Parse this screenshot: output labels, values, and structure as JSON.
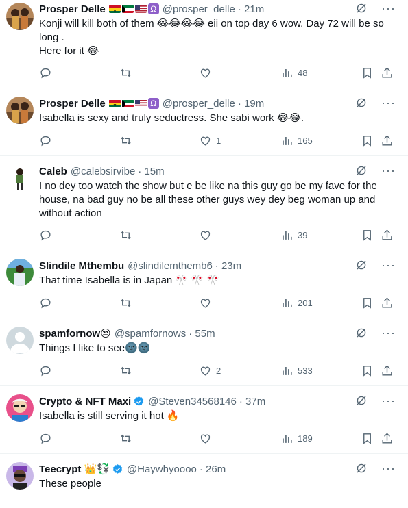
{
  "tweets": [
    {
      "name": "Prosper Delle",
      "handle": "@prosper_delle",
      "time": "· 21m",
      "text": "Konji will kill both of them  😂😂😂😂 eii on top day 6 wow.  Day 72 will be so long .\nHere for it 😂",
      "replies": "",
      "retweets": "",
      "likes": "",
      "views": "48",
      "avatar": "prosper"
    },
    {
      "name": "Prosper Delle",
      "handle": "@prosper_delle",
      "time": "· 19m",
      "text": "Isabella is sexy and truly seductress. She sabi work 😂😂.",
      "replies": "",
      "retweets": "",
      "likes": "1",
      "views": "165",
      "avatar": "prosper"
    },
    {
      "name": "Caleb",
      "handle": "@calebsirvibe",
      "time": "· 15m",
      "text": "I no dey too watch the show but e be like na this guy go be my fave for the house, na bad guy no be all these other guys wey dey beg woman up and without action",
      "replies": "",
      "retweets": "",
      "likes": "",
      "views": "39",
      "avatar": "caleb"
    },
    {
      "name": "Slindile Mthembu",
      "handle": "@slindilemthemb6",
      "time": "· 23m",
      "text": "That time Isabella is in Japan 🎌 🎌 🎌",
      "replies": "",
      "retweets": "",
      "likes": "",
      "views": "201",
      "avatar": "slindile"
    },
    {
      "name": "spamfornow😒",
      "handle": "@spamfornows",
      "time": "· 55m",
      "text": "Things I like to see🌚🌚",
      "replies": "",
      "retweets": "",
      "likes": "2",
      "views": "533",
      "avatar": "default"
    },
    {
      "name": "Crypto & NFT Maxi",
      "handle": "@Steven34568146",
      "time": "· 37m",
      "text": "Isabella is still serving it hot 🔥",
      "replies": "",
      "retweets": "",
      "likes": "",
      "views": "189",
      "avatar": "crypto",
      "verified": true
    },
    {
      "name": "Teecrypt 👑💱",
      "handle": "@Haywhyoooo",
      "time": "· 26m",
      "text": "These people",
      "avatar": "teecrypt",
      "verified": true
    }
  ],
  "colors": {
    "text": "#0f1419",
    "secondary": "#536471",
    "verified": "#1d9bf0",
    "divider": "#eff3f4"
  },
  "icons": [
    "reply-icon",
    "retweet-icon",
    "like-icon",
    "views-icon",
    "bookmark-icon",
    "share-icon",
    "grok-icon",
    "more-icon",
    "verified-icon"
  ]
}
